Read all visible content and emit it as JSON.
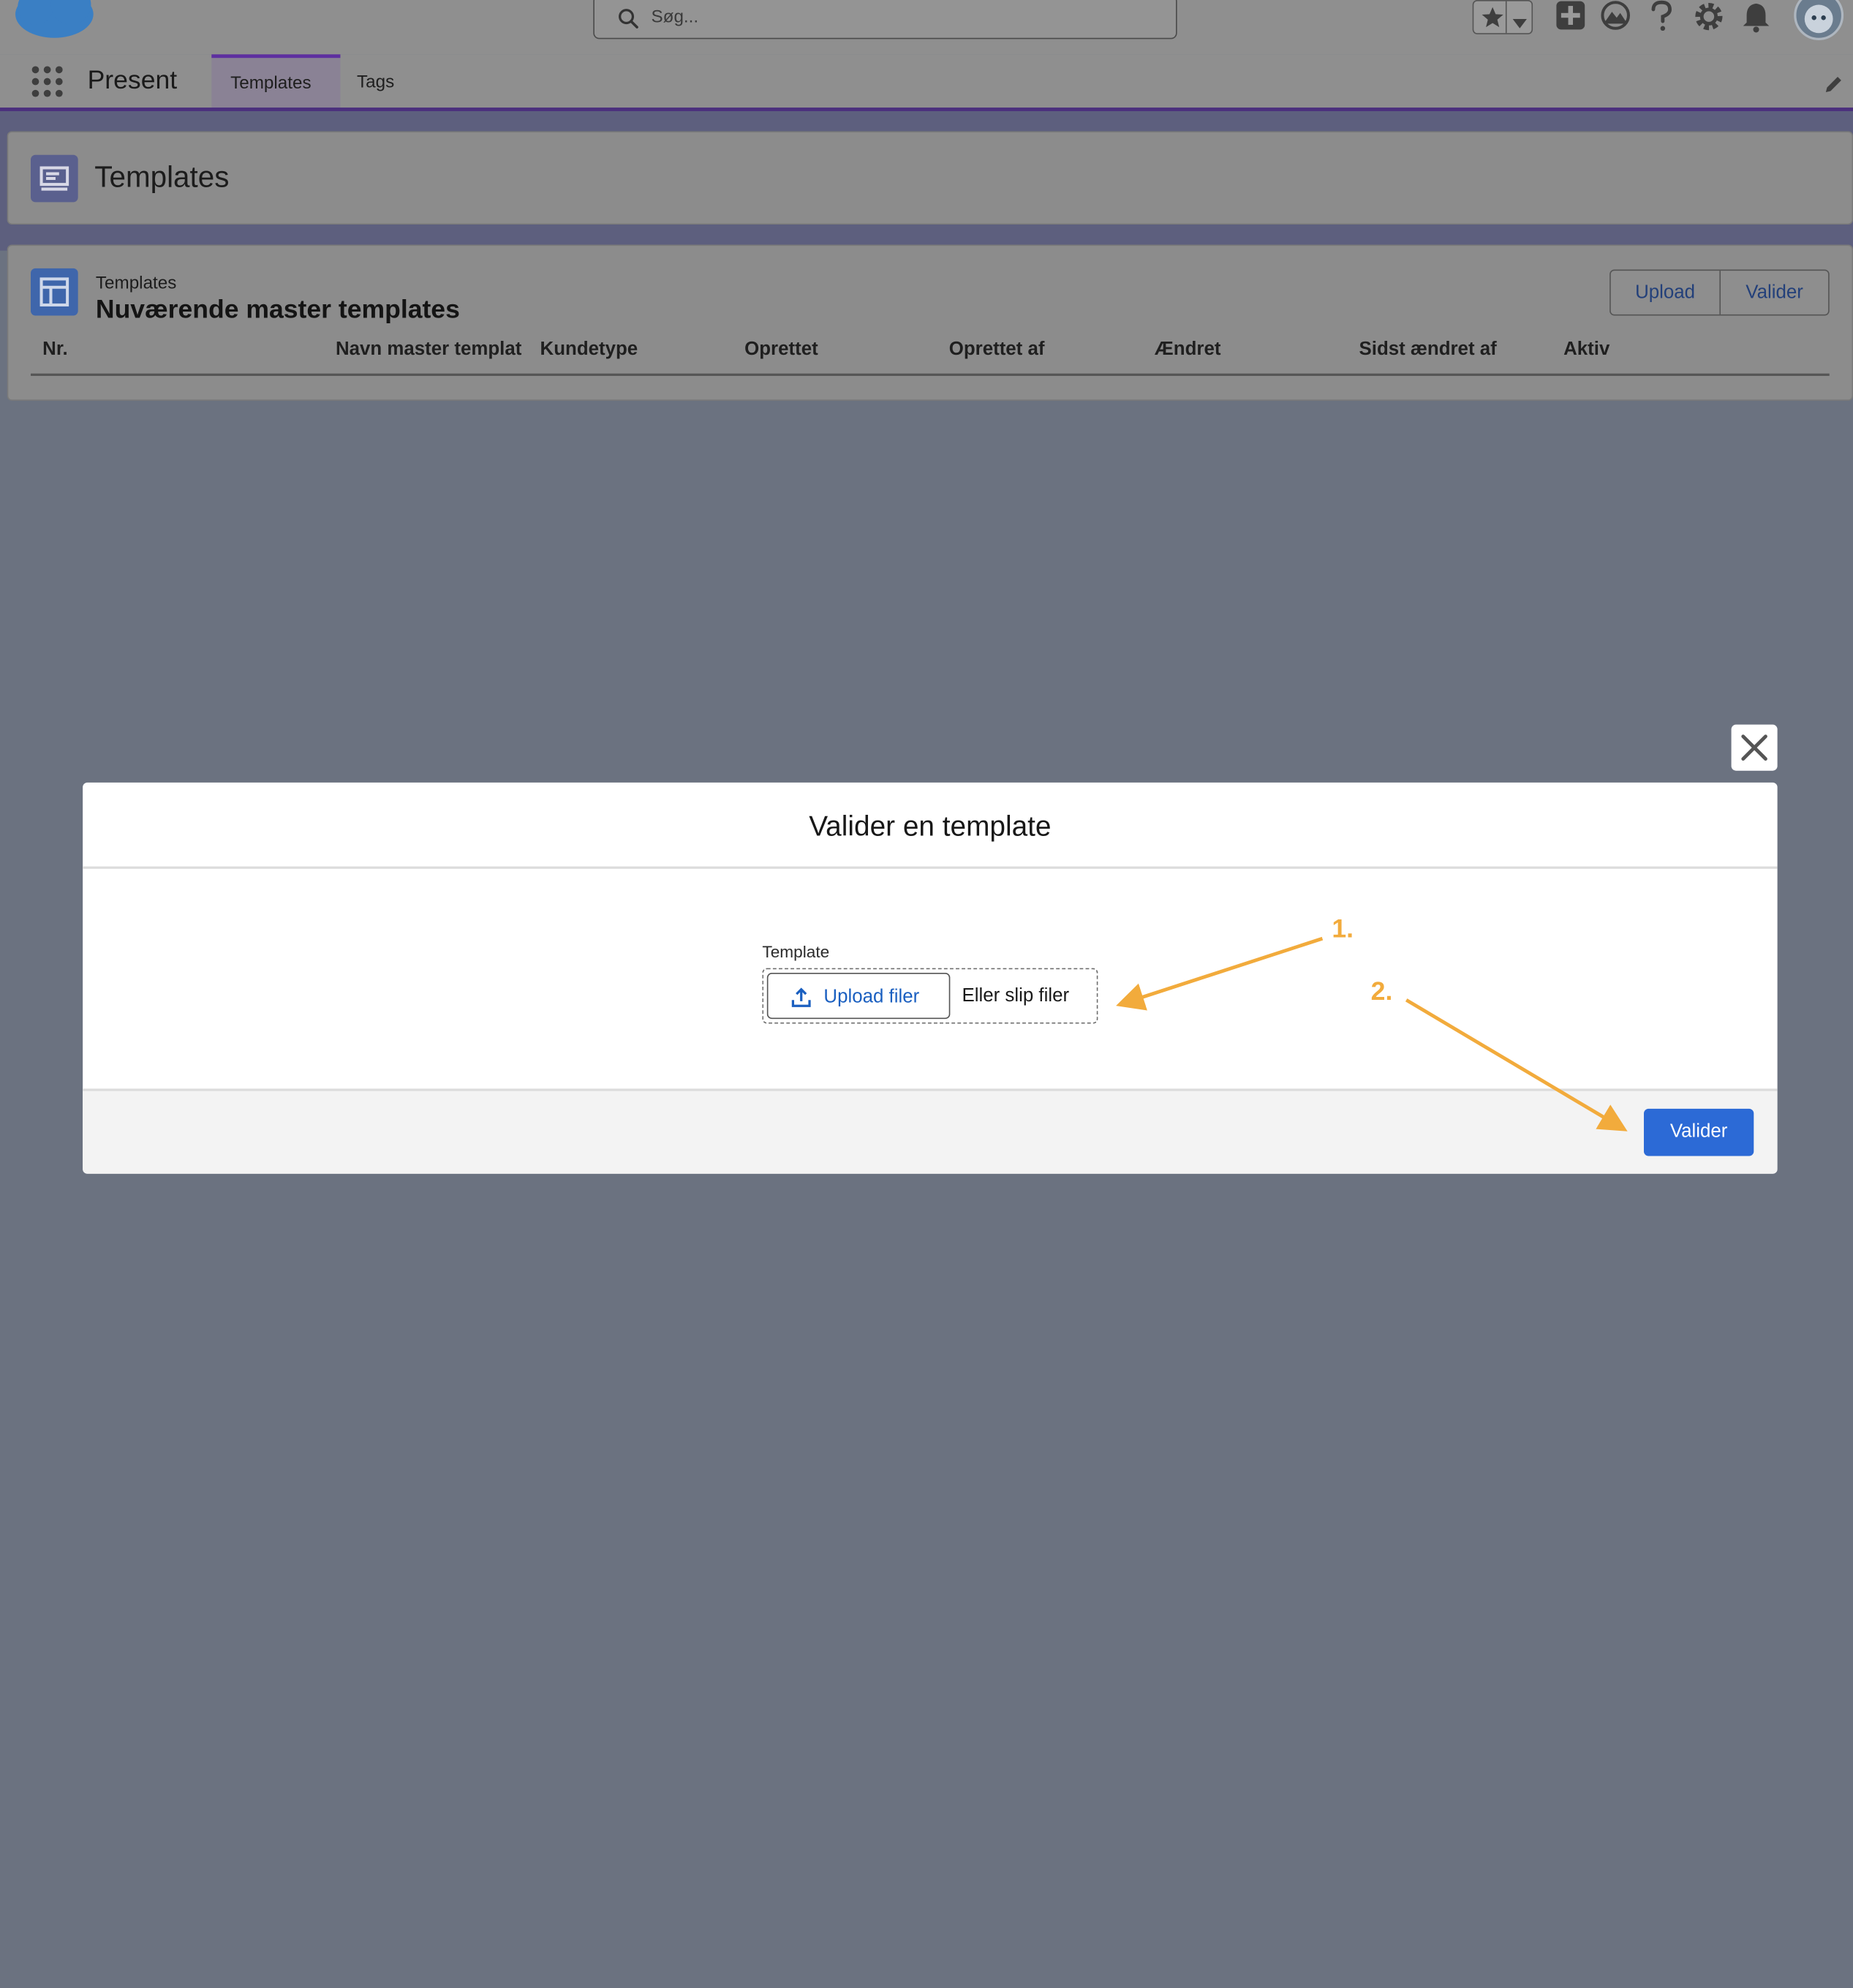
{
  "search": {
    "placeholder": "Søg..."
  },
  "nav": {
    "app_name": "Present",
    "tabs": [
      {
        "label": "Templates",
        "active": true
      },
      {
        "label": "Tags",
        "active": false
      }
    ]
  },
  "page_header": {
    "title": "Templates"
  },
  "list": {
    "object_label": "Templates",
    "title": "Nuværende master templates",
    "buttons": {
      "upload": "Upload",
      "validate": "Valider"
    },
    "columns": [
      "Nr.",
      "Navn master templat",
      "Kundetype",
      "Oprettet",
      "Oprettet af",
      "Ændret",
      "Sidst ændret af",
      "Aktiv"
    ]
  },
  "modal": {
    "title": "Valider en template",
    "field_label": "Template",
    "upload_button": "Upload filer",
    "drop_text": "Eller slip filer",
    "submit_button": "Valider"
  },
  "annotations": {
    "step1": "1.",
    "step2": "2."
  },
  "colors": {
    "accent": "#5d2fa0",
    "brand_button": "#2c6ad6",
    "link": "#1a5fc0",
    "annotation": "#f2ab3c"
  }
}
